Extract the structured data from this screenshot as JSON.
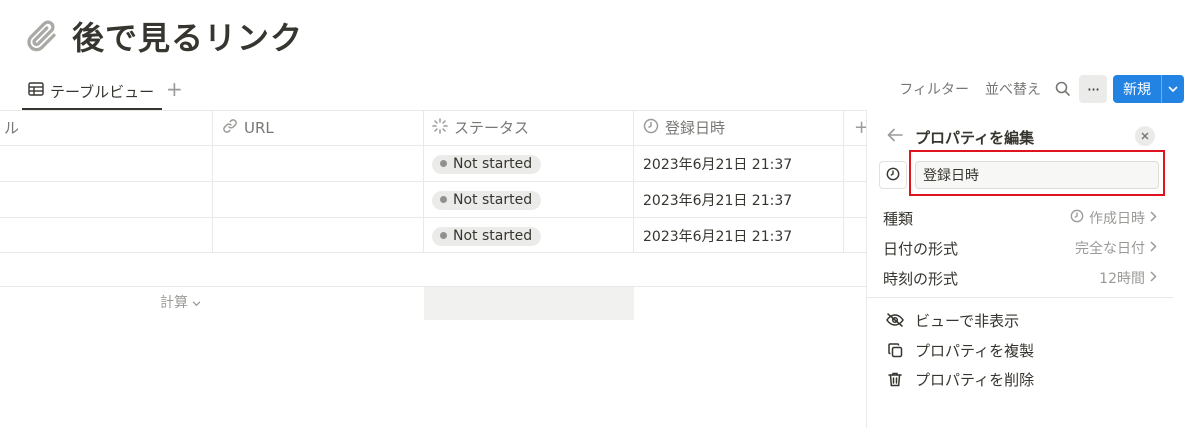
{
  "page": {
    "title": "後で見るリンク",
    "icon": "paperclip-icon"
  },
  "views": {
    "active_tab": "テーブルビュー",
    "add_view": "+"
  },
  "toolbar": {
    "filter": "フィルター",
    "sort": "並べ替え",
    "more": "···",
    "new_label": "新規"
  },
  "table": {
    "columns": [
      {
        "label": "ル",
        "icon": ""
      },
      {
        "label": "URL",
        "icon": "link-icon"
      },
      {
        "label": "ステータス",
        "icon": "status-icon"
      },
      {
        "label": "登録日時",
        "icon": "clock-icon"
      }
    ],
    "add_column": "+",
    "rows": [
      {
        "status": "Not started",
        "date": "2023年6月21日 21:37"
      },
      {
        "status": "Not started",
        "date": "2023年6月21日 21:37"
      },
      {
        "status": "Not started",
        "date": "2023年6月21日 21:37"
      }
    ],
    "calc_label": "計算"
  },
  "panel": {
    "title": "プロパティを編集",
    "name_value": "登録日時",
    "props": [
      {
        "label": "種類",
        "value": "作成日時",
        "icon": "clock-icon"
      },
      {
        "label": "日付の形式",
        "value": "完全な日付"
      },
      {
        "label": "時刻の形式",
        "value": "12時間"
      }
    ],
    "actions": [
      {
        "label": "ビューで非表示",
        "icon": "eye-off-icon"
      },
      {
        "label": "プロパティを複製",
        "icon": "duplicate-icon"
      },
      {
        "label": "プロパティを削除",
        "icon": "trash-icon"
      }
    ]
  },
  "colors": {
    "accent": "#2383e2",
    "highlight": "#e0141e"
  }
}
